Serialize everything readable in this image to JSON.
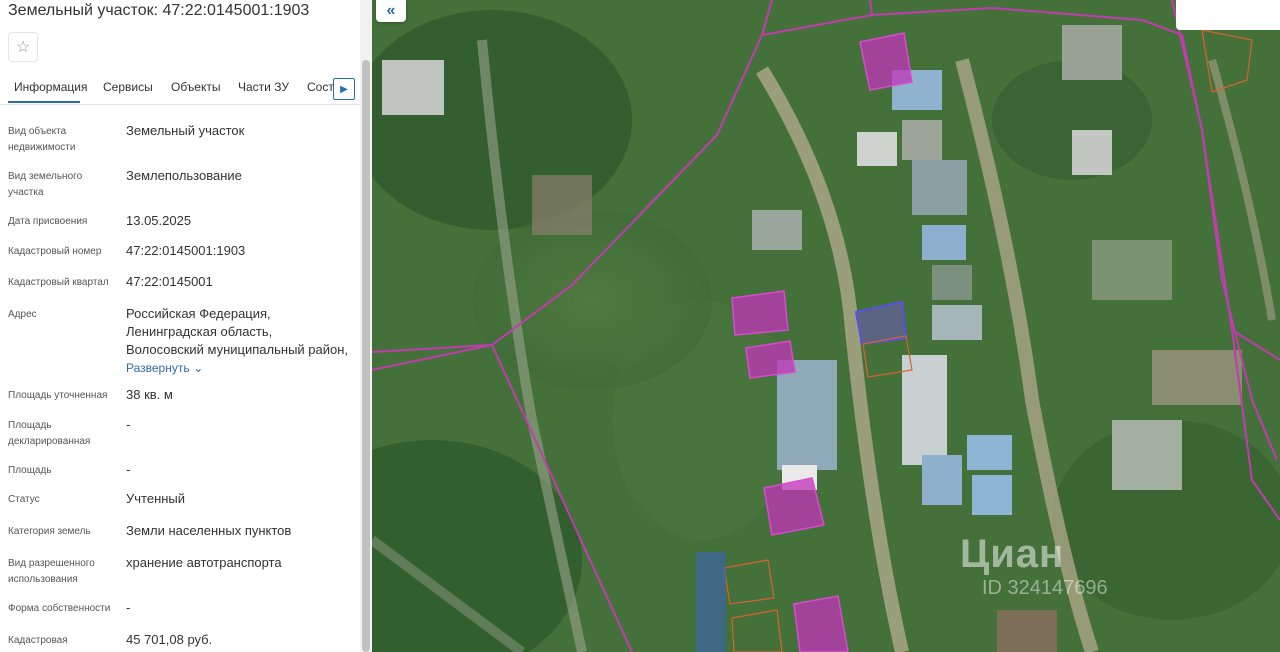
{
  "title": "Земельный участок: 47:22:0145001:1903",
  "tabs": [
    "Информация",
    "Сервисы",
    "Объекты",
    "Части ЗУ",
    "Соста"
  ],
  "fields": [
    {
      "label": "Вид объекта недвижимости",
      "value": "Земельный участок"
    },
    {
      "label": "Вид земельного участка",
      "value": "Землепользование"
    },
    {
      "label": "Дата присвоения",
      "value": "13.05.2025"
    },
    {
      "label": "Кадастровый номер",
      "value": "47:22:0145001:1903"
    },
    {
      "label": "Кадастровый квартал",
      "value": "47:22:0145001"
    },
    {
      "label": "Адрес",
      "value_lines": [
        "Российская Федерация,",
        "Ленинградская область,",
        "Волосовский муниципальный район,"
      ],
      "expand_label": "Развернуть"
    },
    {
      "label": "Площадь уточненная",
      "value": "38 кв. м"
    },
    {
      "label": "Площадь декларированная",
      "value": "-"
    },
    {
      "label": "Площадь",
      "value": "-"
    },
    {
      "label": "Статус",
      "value": "Учтенный"
    },
    {
      "label": "Категория земель",
      "value": "Земли населенных пунктов"
    },
    {
      "label": "Вид разрешенного использования",
      "value": "хранение автотранспорта"
    },
    {
      "label": "Форма собственности",
      "value": "-"
    },
    {
      "label": "Кадастровая",
      "value": "45 701,08 руб."
    }
  ],
  "map": {
    "watermark": "Циан",
    "watermark_id": "ID 324147696",
    "boundary_color": "#c23bb0",
    "parcel_fill": "#c233b8",
    "selected_color": "#5a4ee8",
    "neighbor_color": "#d9622b"
  },
  "icons": {
    "favorite": "star-icon",
    "next": "chevron-right-icon",
    "expand": "chevron-down-icon",
    "collapse": "double-chevron-left-icon"
  }
}
